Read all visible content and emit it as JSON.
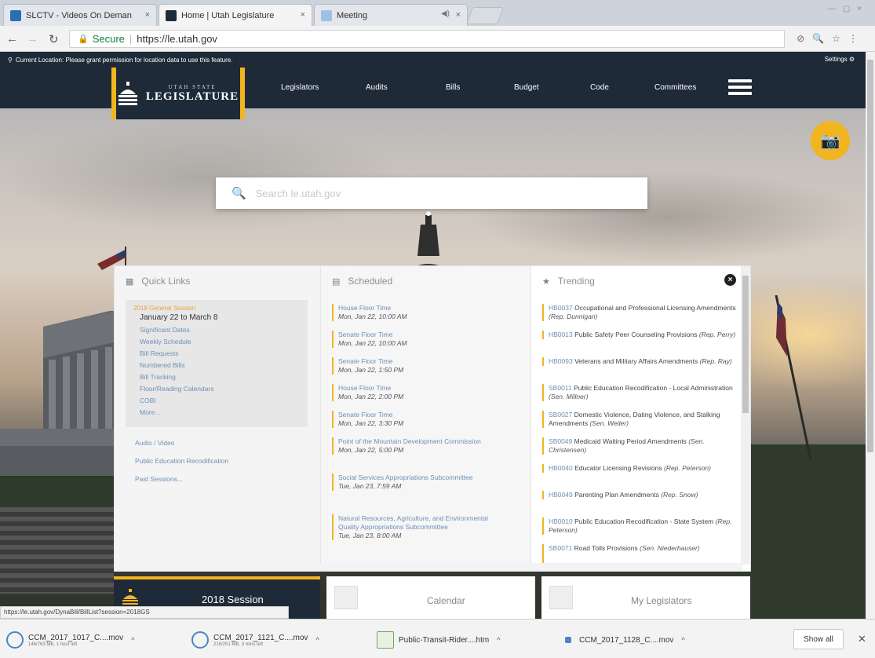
{
  "browser": {
    "tabs": [
      {
        "title": "SLCTV - Videos On Deman",
        "active": false
      },
      {
        "title": "Home | Utah Legislature",
        "active": true
      },
      {
        "title": "Meeting",
        "active": false
      }
    ],
    "address": {
      "secure_label": "Secure",
      "url": "https://le.utah.gov"
    },
    "status_url": "https://le.utah.gov/DynaBill/BillList?session=2018GS"
  },
  "site": {
    "location_notice": "Current Location: Please grant permission for location data to use this feature.",
    "settings_label": "Settings",
    "logo_top": "UTAH STATE",
    "logo_main": "LEGISLATURE",
    "nav": [
      "Legislators",
      "Audits",
      "Bills",
      "Budget",
      "Code",
      "Committees"
    ],
    "search_placeholder": "Search le.utah.gov"
  },
  "quick_links": {
    "heading": "Quick Links",
    "session_title": "2018 General Session",
    "session_dates": "January 22 to March 8",
    "session_links": [
      "Significant Dates",
      "Weekly Schedule",
      "Bill Requests",
      "Numbered Bills",
      "Bill Tracking",
      "Floor/Reading Calendars",
      "COBI",
      "More..."
    ],
    "links": [
      "Audio / Video",
      "Public Education Recodification",
      "Past Sessions..."
    ]
  },
  "scheduled": {
    "heading": "Scheduled",
    "items": [
      {
        "name": "House Floor Time",
        "time": "Mon, Jan 22, 10:00 AM"
      },
      {
        "name": "Senate Floor Time",
        "time": "Mon, Jan 22, 10:00 AM"
      },
      {
        "name": "Senate Floor Time",
        "time": "Mon, Jan 22, 1:50 PM"
      },
      {
        "name": "House Floor Time",
        "time": "Mon, Jan 22, 2:00 PM"
      },
      {
        "name": "Senate Floor Time",
        "time": "Mon, Jan 22, 3:30 PM"
      },
      {
        "name": "Point of the Mountain Development Commission",
        "time": "Mon, Jan 22, 5:00 PM"
      },
      {
        "name": "Social Services Appropriations Subcommittee",
        "time": "Tue, Jan 23, 7:59 AM"
      },
      {
        "name": "Natural Resources, Agriculture, and Environmental Quality Appropriations Subcommittee",
        "time": "Tue, Jan 23, 8:00 AM"
      }
    ]
  },
  "trending": {
    "heading": "Trending",
    "items": [
      {
        "code": "HB0037",
        "title": "Occupational and Professional Licensing Amendments",
        "sponsor": "(Rep. Dunnigan)"
      },
      {
        "code": "HB0013",
        "title": "Public Safety Peer Counseling Provisions",
        "sponsor": "(Rep. Perry)"
      },
      {
        "code": "HB0093",
        "title": "Veterans and Military Affairs Amendments",
        "sponsor": "(Rep. Ray)"
      },
      {
        "code": "SB0011",
        "title": "Public Education Recodification - Local Administration",
        "sponsor": "(Sen. Millner)"
      },
      {
        "code": "SB0027",
        "title": "Domestic Violence, Dating Violence, and Stalking Amendments",
        "sponsor": "(Sen. Weiler)"
      },
      {
        "code": "SB0049",
        "title": "Medicaid Waiting Period Amendments",
        "sponsor": "(Sen. Christensen)"
      },
      {
        "code": "HB0040",
        "title": "Educator Licensing Revisions",
        "sponsor": "(Rep. Peterson)"
      },
      {
        "code": "HB0049",
        "title": "Parenting Plan Amendments",
        "sponsor": "(Rep. Snow)"
      },
      {
        "code": "HB0010",
        "title": "Public Education Recodification - State System",
        "sponsor": "(Rep. Peterson)"
      },
      {
        "code": "SB0071",
        "title": "Road Tolls Provisions",
        "sponsor": "(Sen. Niederhauser)"
      }
    ]
  },
  "tiles": {
    "session": "2018 Session",
    "calendar": "Calendar",
    "legislators": "My Legislators"
  },
  "downloads": [
    {
      "name": "CCM_2017_1017_C....mov",
      "meta": "146/763 MB, 1 hour left"
    },
    {
      "name": "CCM_2017_1121_C....mov",
      "meta": "216/251 MB, 3 mins left"
    },
    {
      "name": "Public-Transit-Rider....htm",
      "meta": ""
    },
    {
      "name": "CCM_2017_1128_C....mov",
      "meta": ""
    }
  ],
  "show_all": "Show all",
  "colors": {
    "navy": "#1f2a38",
    "gold": "#f2b51f",
    "link": "#6d8fb5"
  }
}
